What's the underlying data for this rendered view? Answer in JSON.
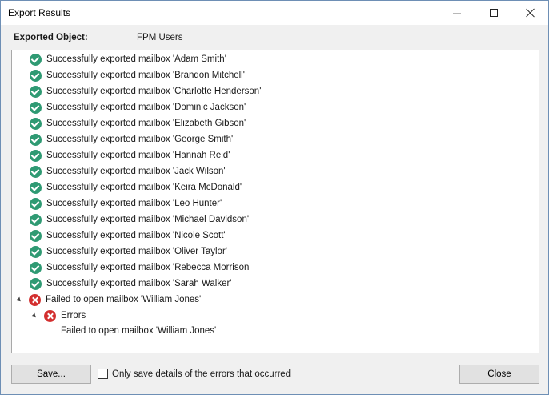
{
  "window": {
    "title": "Export Results",
    "controls": {
      "minimize": "minimize",
      "maximize": "maximize",
      "close": "close"
    }
  },
  "header": {
    "object_label": "Exported Object:",
    "object_value": "FPM Users"
  },
  "results": {
    "success_rows": [
      "Successfully exported mailbox 'Adam Smith'",
      "Successfully exported mailbox 'Brandon Mitchell'",
      "Successfully exported mailbox 'Charlotte Henderson'",
      "Successfully exported mailbox 'Dominic Jackson'",
      "Successfully exported mailbox 'Elizabeth Gibson'",
      "Successfully exported mailbox 'George Smith'",
      "Successfully exported mailbox 'Hannah Reid'",
      "Successfully exported mailbox 'Jack Wilson'",
      "Successfully exported mailbox 'Keira McDonald'",
      "Successfully exported mailbox 'Leo Hunter'",
      "Successfully exported mailbox 'Michael Davidson'",
      "Successfully exported mailbox 'Nicole Scott'",
      "Successfully exported mailbox 'Oliver Taylor'",
      "Successfully exported mailbox 'Rebecca Morrison'",
      "Successfully exported mailbox 'Sarah Walker'"
    ],
    "failure_row": "Failed to open mailbox 'William Jones'",
    "errors_label": "Errors",
    "error_detail": "Failed to open mailbox 'William Jones'"
  },
  "footer": {
    "save_label": "Save...",
    "only_errors_label": "Only save details of the errors that occurred",
    "only_errors_checked": false,
    "close_label": "Close"
  },
  "colors": {
    "success": "#2f9a73",
    "error": "#d32f2f"
  },
  "icons": {
    "success": "check-circle-icon",
    "error": "error-circle-icon",
    "expander": "expand-triangle-icon"
  }
}
